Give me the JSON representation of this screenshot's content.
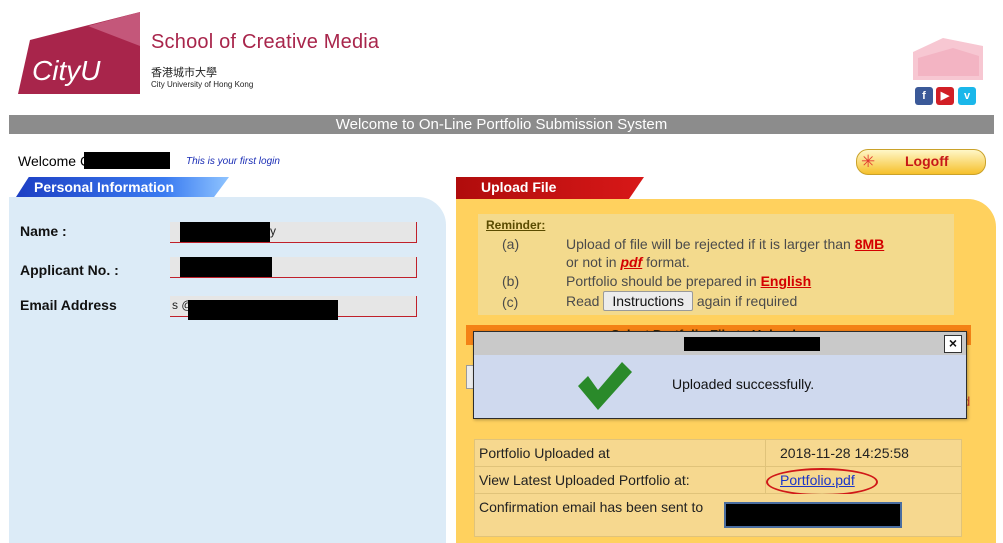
{
  "header": {
    "logo_text": "CityU",
    "school_name": "School of Creative Media",
    "university_cn": "香港城市大學",
    "university_en": "City University of Hong Kong",
    "social": [
      "f",
      "▶",
      "v"
    ]
  },
  "banner": {
    "title": "Welcome to On-Line Portfolio Submission System"
  },
  "user_bar": {
    "welcome": "Welcome C",
    "first_login": "This is your first login",
    "logoff": "Logoff"
  },
  "personal_info": {
    "tab": "Personal Information",
    "name_label": "Name :",
    "applicant_label": "Applicant No. :",
    "email_label": "Email Address",
    "name_tail": "y",
    "email_visible": "s                    @c              .hk"
  },
  "upload": {
    "tab": "Upload File",
    "reminder_title": "Reminder:",
    "items": [
      {
        "letter": "(a)",
        "text_before": "Upload of file will be rejected if it is larger than ",
        "link": "8MB"
      },
      {
        "letter": "",
        "text_before": "or not in ",
        "link": "pdf",
        "text_after": " format."
      },
      {
        "letter": "(b)",
        "text_before": "Portfolio should be prepared in ",
        "link": "English"
      },
      {
        "letter": "(c)",
        "text_before": "Read ",
        "button": "Instructions",
        "text_after": " again if required"
      }
    ],
    "select_title": "Select Portfolio File to Upload"
  },
  "dialog": {
    "message": "Uploaded successfully.",
    "close": "×"
  },
  "info_table": {
    "uploaded_at_label": "Portfolio Uploaded at",
    "uploaded_at_value": "2018-11-28 14:25:58",
    "view_label": "View Latest Uploaded Portfolio at:",
    "view_link": "Portfolio.pdf",
    "email_sent_label": "Confirmation email has been sent to"
  },
  "colors": {
    "brand_red": "#a8254b",
    "banner_gray": "#8c8c8c",
    "panel_blue": "#dcebf7",
    "panel_yellow": "#ffd15e",
    "success_green": "#2a8a2a"
  }
}
